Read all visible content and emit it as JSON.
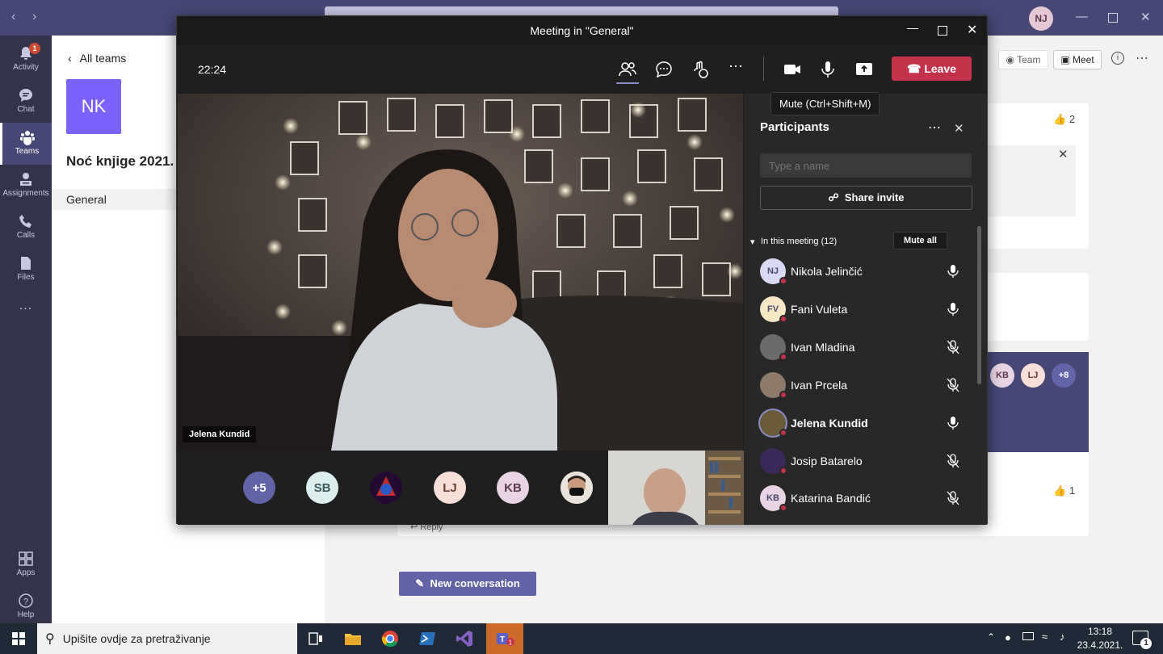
{
  "teams": {
    "me_initials": "NJ",
    "rail": [
      {
        "label": "Activity",
        "badge": "1"
      },
      {
        "label": "Chat"
      },
      {
        "label": "Teams"
      },
      {
        "label": "Assignments"
      },
      {
        "label": "Calls"
      },
      {
        "label": "Files"
      },
      {
        "label": "..."
      },
      {
        "label": "Apps"
      },
      {
        "label": "Help"
      }
    ],
    "back_label": "All teams",
    "team_initials": "NK",
    "team_name": "Noć knjige 2021.",
    "channel": "General",
    "header_team": "Team",
    "header_meet": "Meet",
    "likes_1": "2",
    "likes_2": "1",
    "reply_label": "Reply",
    "new_conversation": "New conversation",
    "avatars": [
      "KB",
      "LJ",
      "+8"
    ]
  },
  "meeting": {
    "title": "Meeting in \"General\"",
    "timer": "22:24",
    "leave_label": "Leave",
    "tooltip": "Mute (Ctrl+Shift+M)",
    "main_speaker": "Jelena Kundid",
    "strip": [
      "+5",
      "SB",
      "",
      "LJ",
      "KB",
      ""
    ],
    "panel": {
      "title": "Participants",
      "search_placeholder": "Type a name",
      "share_invite": "Share invite",
      "in_meeting": "In this meeting (12)",
      "mute_all": "Mute all",
      "participants": [
        {
          "initials": "NJ",
          "name": "Nikola Jelinčić",
          "muted": false,
          "bg": "#d9d9f5"
        },
        {
          "initials": "FV",
          "name": "Fani Vuleta",
          "muted": false,
          "bg": "#f6e8c5"
        },
        {
          "initials": "",
          "name": "Ivan Mladina",
          "muted": true,
          "bg": "#6b6b6b"
        },
        {
          "initials": "",
          "name": "Ivan Prcela",
          "muted": true,
          "bg": "#8c7a6a"
        },
        {
          "initials": "",
          "name": "Jelena Kundid",
          "muted": false,
          "bg": "#6a5b3a"
        },
        {
          "initials": "",
          "name": "Josip Batarelo",
          "muted": true,
          "bg": "#3a2a5a"
        },
        {
          "initials": "KB",
          "name": "Katarina Bandić",
          "muted": true,
          "bg": "#e8d4e4"
        }
      ]
    }
  },
  "taskbar": {
    "search_placeholder": "Upišite ovdje za pretraživanje",
    "time": "13:18",
    "date": "23.4.2021.",
    "notifications": "1"
  }
}
